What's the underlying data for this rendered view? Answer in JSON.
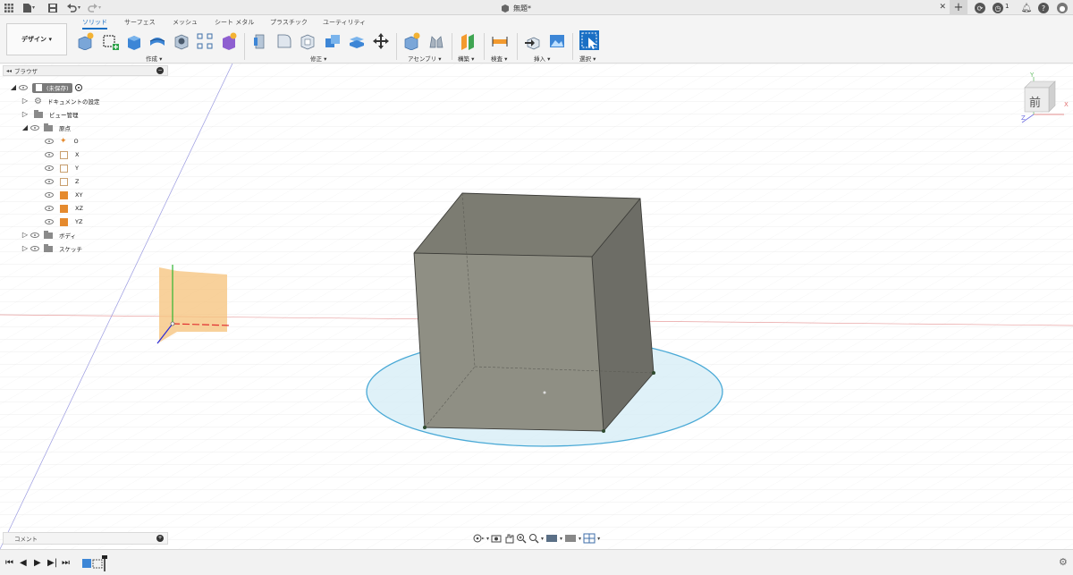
{
  "title_bar": {
    "document_title": "無題*",
    "notification_count": "1"
  },
  "workspace": {
    "label": "デザイン ▾"
  },
  "tabs": [
    {
      "label": "ソリッド",
      "active": true
    },
    {
      "label": "サーフェス",
      "active": false
    },
    {
      "label": "メッシュ",
      "active": false
    },
    {
      "label": "シート メタル",
      "active": false
    },
    {
      "label": "プラスチック",
      "active": false
    },
    {
      "label": "ユーティリティ",
      "active": false
    }
  ],
  "groups": {
    "create": "作成 ▾",
    "modify": "修正 ▾",
    "assemble": "アセンブリ ▾",
    "construct": "構築 ▾",
    "inspect": "検査 ▾",
    "insert": "挿入 ▾",
    "select": "選択 ▾"
  },
  "browser": {
    "title": "ブラウザ",
    "root": "(未保存)",
    "items": {
      "doc_settings": "ドキュメントの設定",
      "named_views": "ビュー管理",
      "origin": "原点",
      "origin_o": "O",
      "origin_x": "X",
      "origin_y": "Y",
      "origin_z": "Z",
      "origin_xy": "XY",
      "origin_xz": "XZ",
      "origin_yz": "YZ",
      "bodies": "ボディ",
      "sketches": "スケッチ"
    }
  },
  "comments": {
    "label": "コメント"
  },
  "viewcube": {
    "face_label": "前",
    "axis_x": "X",
    "axis_y": "Y",
    "axis_z": "Z"
  },
  "colors": {
    "accent": "#1a6fc4",
    "cube_front": "#8f8f84",
    "cube_top": "#7c7c72",
    "cube_side": "#6d6d66",
    "sketch_fill": "#d4ecf6",
    "sketch_stroke": "#49a9d6",
    "origin_plane": "#f6c27a"
  }
}
